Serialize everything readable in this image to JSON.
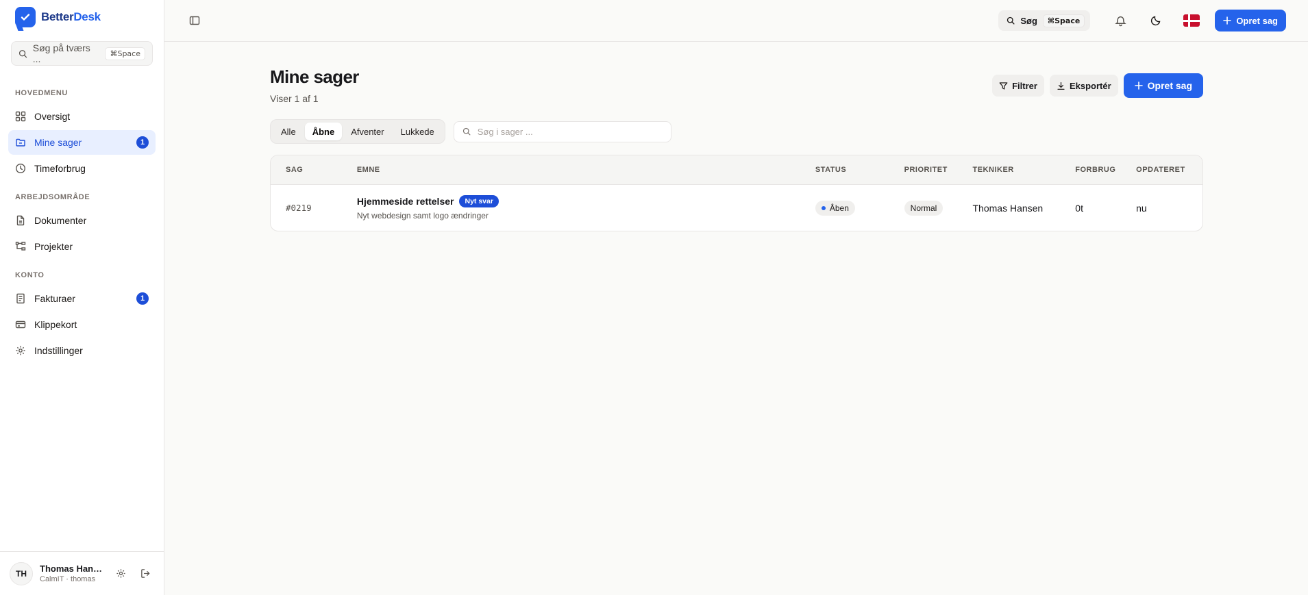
{
  "brand": {
    "name_a": "Better",
    "name_b": "Desk"
  },
  "sidebar": {
    "search_placeholder": "Søg på tværs ...",
    "search_kbd": "⌘Space",
    "sections": {
      "main": "HOVEDMENU",
      "work": "ARBEJDSOMRÅDE",
      "account": "KONTO"
    },
    "items": {
      "overview": "Oversigt",
      "my_cases": "Mine sager",
      "my_cases_badge": "1",
      "time": "Timeforbrug",
      "documents": "Dokumenter",
      "projects": "Projekter",
      "invoices": "Fakturaer",
      "invoices_badge": "1",
      "punchcard": "Klippekort",
      "settings": "Indstillinger"
    },
    "user": {
      "initials": "TH",
      "name": "Thomas Hans...",
      "sub": "CalmIT · thomas"
    }
  },
  "topbar": {
    "search_label": "Søg",
    "search_kbd": "⌘Space",
    "create_label": "Opret sag"
  },
  "page": {
    "title": "Mine sager",
    "subtitle": "Viser 1 af 1",
    "filter_label": "Filtrer",
    "export_label": "Eksportér",
    "create_label": "Opret sag",
    "tabs": {
      "all": "Alle",
      "open": "Åbne",
      "waiting": "Afventer",
      "closed": "Lukkede"
    },
    "search_placeholder": "Søg i sager ..."
  },
  "table": {
    "headers": {
      "sag": "SAG",
      "emne": "EMNE",
      "status": "STATUS",
      "prioritet": "PRIORITET",
      "tekniker": "TEKNIKER",
      "forbrug": "FORBRUG",
      "opdateret": "OPDATERET"
    },
    "rows": [
      {
        "id": "#0219",
        "subject": "Hjemmeside rettelser",
        "badge": "Nyt svar",
        "description": "Nyt webdesign samt logo ændringer",
        "status": "Åben",
        "priority": "Normal",
        "technician": "Thomas Hansen",
        "usage": "0t",
        "updated": "nu"
      }
    ]
  },
  "colors": {
    "accent": "#2563eb",
    "active_bg": "#e8efff",
    "flag_red": "#c8102e"
  }
}
